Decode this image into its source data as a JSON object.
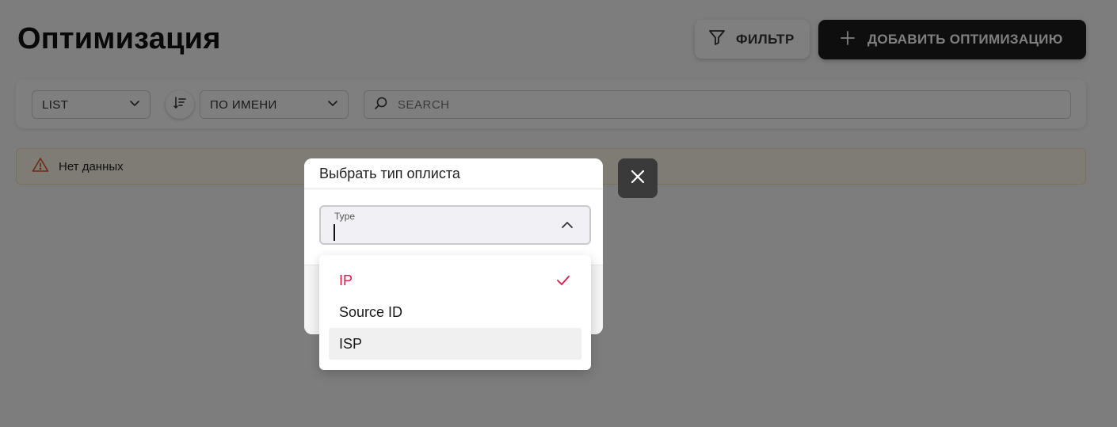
{
  "page": {
    "title": "Оптимизация",
    "filter_label": "ФИЛЬТР",
    "add_label": "ДОБАВИТЬ ОПТИМИЗАЦИЮ"
  },
  "toolbar": {
    "view_select": "LIST",
    "sort_select": "ПО ИМЕНИ",
    "search_placeholder": "SEARCH"
  },
  "alert": {
    "text": "Нет данных"
  },
  "modal": {
    "title": "Выбрать тип оплиста",
    "type_field": {
      "label": "Type",
      "value": ""
    },
    "options": [
      {
        "label": "IP",
        "selected": true
      },
      {
        "label": "Source ID",
        "selected": false
      },
      {
        "label": "ISP",
        "selected": false,
        "hovered": true
      }
    ]
  },
  "colors": {
    "accent": "#d9184a",
    "primary_button": "#1d1d1f",
    "overlay": "rgba(0,0,0,0.5)",
    "warning_icon": "#d9542f"
  },
  "icons": {
    "filter": "filter-icon",
    "add": "plus-icon",
    "sort": "sort-icon",
    "search": "search-icon",
    "warning": "warning-icon",
    "close": "close-icon",
    "chevron": "chevron-up-icon",
    "check": "check-icon"
  }
}
